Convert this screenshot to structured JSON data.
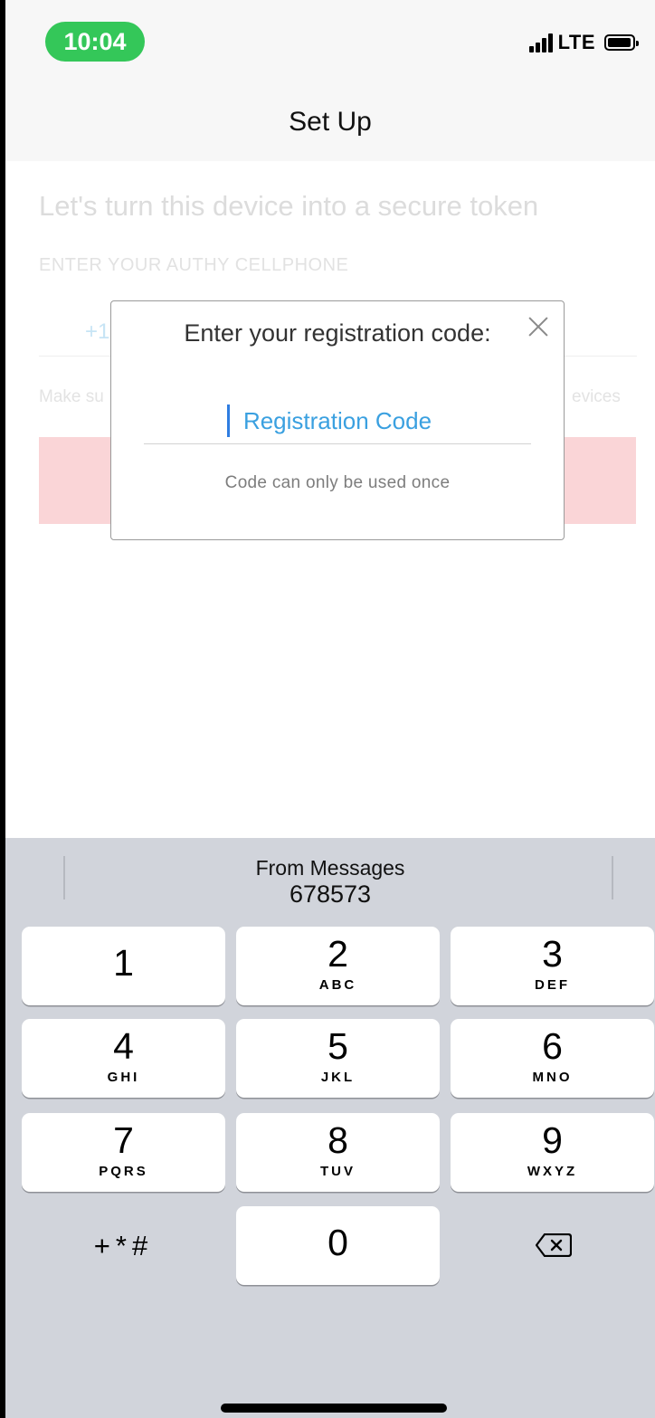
{
  "status_bar": {
    "time": "10:04",
    "network": "LTE",
    "accent_color": "#34c759"
  },
  "nav": {
    "title": "Set Up"
  },
  "background": {
    "headline": "Let's turn this device into a secure token",
    "phone_label": "ENTER YOUR AUTHY CELLPHONE",
    "country_code": "+1",
    "note_left": "Make su",
    "note_right": "evices",
    "cta_color": "#fad5d7"
  },
  "modal": {
    "title": "Enter your registration code:",
    "input_placeholder": "Registration Code",
    "input_value": "",
    "hint": "Code can only be used once",
    "close_icon": "close-icon"
  },
  "keyboard": {
    "suggestion": {
      "source": "From Messages",
      "code": "678573"
    },
    "keys": [
      {
        "digit": "1",
        "letters": ""
      },
      {
        "digit": "2",
        "letters": "ABC"
      },
      {
        "digit": "3",
        "letters": "DEF"
      },
      {
        "digit": "4",
        "letters": "GHI"
      },
      {
        "digit": "5",
        "letters": "JKL"
      },
      {
        "digit": "6",
        "letters": "MNO"
      },
      {
        "digit": "7",
        "letters": "PQRS"
      },
      {
        "digit": "8",
        "letters": "TUV"
      },
      {
        "digit": "9",
        "letters": "WXYZ"
      },
      {
        "digit": "0",
        "letters": ""
      }
    ],
    "symbols_label": "+*#",
    "delete_icon": "backspace-icon"
  }
}
